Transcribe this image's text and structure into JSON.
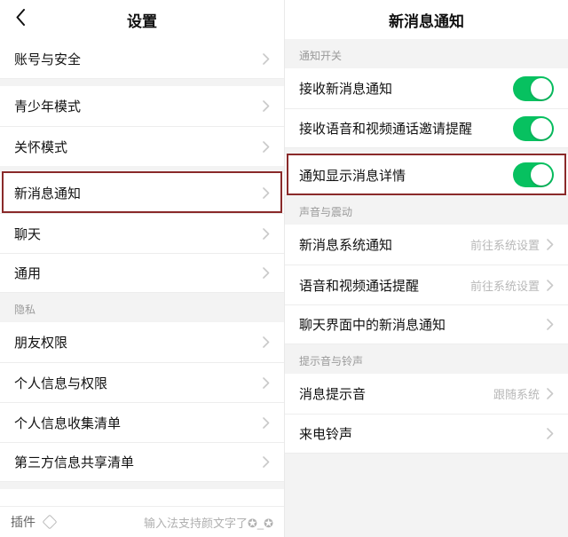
{
  "left": {
    "title": "设置",
    "rows": {
      "account": "账号与安全",
      "youth": "青少年模式",
      "care": "关怀模式",
      "newMsg": "新消息通知",
      "chat": "聊天",
      "general": "通用",
      "section_privacy": "隐私",
      "friend": "朋友权限",
      "pii": "个人信息与权限",
      "piList": "个人信息收集清单",
      "tpList": "第三方信息共享清单"
    },
    "ime": {
      "tag": "插件",
      "placeholder": "输入法支持颜文字了",
      "glyph": "✪_✪"
    }
  },
  "right": {
    "title": "新消息通知",
    "section_switch": "通知开关",
    "toggle_receive": "接收新消息通知",
    "toggle_voip": "接收语音和视频通话邀请提醒",
    "toggle_detail": "通知显示消息详情",
    "section_sound": "声音与震动",
    "sys_notice": {
      "label": "新消息系统通知",
      "sub": "前往系统设置"
    },
    "voip_remind": {
      "label": "语音和视频通话提醒",
      "sub": "前往系统设置"
    },
    "in_chat": "聊天界面中的新消息通知",
    "section_tone": "提示音与铃声",
    "msg_sound": {
      "label": "消息提示音",
      "sub": "跟随系统"
    },
    "call_ring": {
      "label": "来电铃声",
      "sub": ""
    }
  }
}
